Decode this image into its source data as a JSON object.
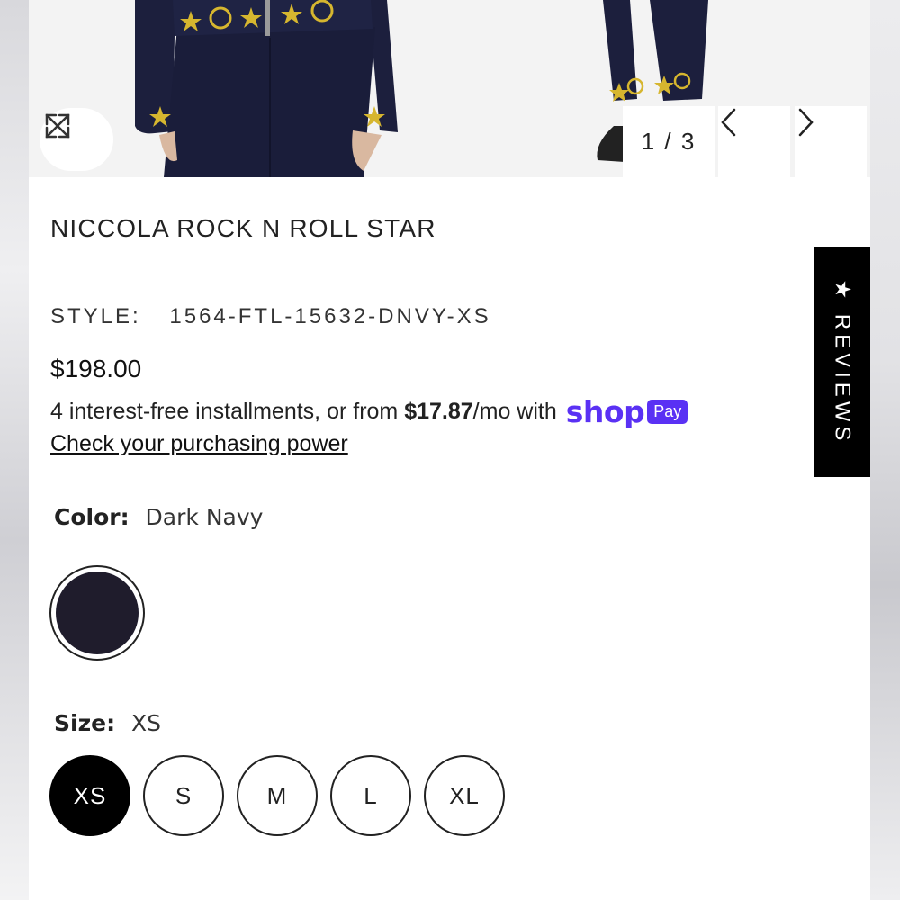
{
  "gallery": {
    "counter": "1 / 3",
    "expand_icon": "expand-arrows-icon",
    "prev_icon": "chevron-left-icon",
    "next_icon": "chevron-right-icon"
  },
  "product": {
    "title": "NICCOLA ROCK N ROLL STAR",
    "style_label": "STYLE:",
    "style_code": "1564-FTL-15632-DNVY-XS",
    "price": "$198.00"
  },
  "installments": {
    "prefix": "4 interest-free installments, or from ",
    "amount": "$17.87",
    "suffix": "/mo with",
    "shop_word": "shop",
    "pay_badge": "Pay",
    "link": "Check your purchasing power"
  },
  "color": {
    "label": "Color:",
    "value": "Dark Navy",
    "swatch_hex": "#1f1c2c"
  },
  "size": {
    "label": "Size:",
    "value": "XS",
    "options": [
      "XS",
      "S",
      "M",
      "L",
      "XL"
    ],
    "selected": "XS"
  },
  "reviews_tab": {
    "label": "★ REVIEWS"
  },
  "colors": {
    "accent_shoppay": "#5a31f4",
    "selected_size_bg": "#000000"
  }
}
